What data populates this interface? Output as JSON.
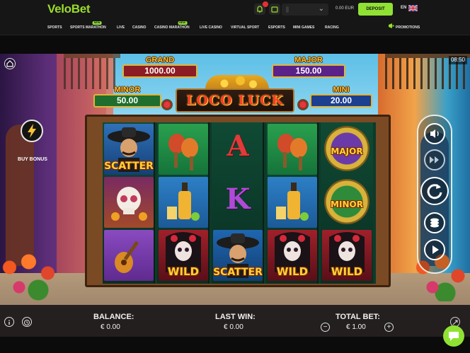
{
  "header": {
    "logo": "VeloBet",
    "balance_amount": "0.00",
    "balance_currency": "EUR",
    "deposit_label": "DEPOSIT",
    "language": "EN"
  },
  "nav": {
    "items": [
      {
        "label": "SPORTS"
      },
      {
        "label": "SPORTS MARATHON",
        "badge": "NEW"
      },
      {
        "label": "LIVE"
      },
      {
        "label": "CASINO"
      },
      {
        "label": "CASINO MARATHON",
        "badge": "NEW"
      },
      {
        "label": "LIVE CASINO"
      },
      {
        "label": "VIRTUAL SPORT"
      },
      {
        "label": "ESPORTS"
      },
      {
        "label": "MINI GAMES"
      },
      {
        "label": "RACING"
      }
    ],
    "promotions": "PROMOTIONS"
  },
  "game": {
    "clock": "08:50",
    "title": "LOCO LUCK",
    "jackpots": {
      "grand": {
        "label": "GRAND",
        "value": "1000.00"
      },
      "major": {
        "label": "MAJOR",
        "value": "150.00"
      },
      "minor": {
        "label": "MINOR",
        "value": "50.00"
      },
      "mini": {
        "label": "MINI",
        "value": "20.00"
      }
    },
    "buy_bonus": "BUY BONUS",
    "reels": [
      [
        {
          "symbol": "mariachi",
          "label": "SCATTER"
        },
        {
          "symbol": "skull",
          "label": ""
        },
        {
          "symbol": "guitar",
          "label": ""
        }
      ],
      [
        {
          "symbol": "maracas",
          "label": ""
        },
        {
          "symbol": "tequila",
          "label": ""
        },
        {
          "symbol": "catrina",
          "label": "WILD"
        }
      ],
      [
        {
          "symbol": "letter",
          "label": "A"
        },
        {
          "symbol": "letter",
          "label": "K"
        },
        {
          "symbol": "mariachi",
          "label": "SCATTER"
        }
      ],
      [
        {
          "symbol": "maracas",
          "label": ""
        },
        {
          "symbol": "tequila",
          "label": ""
        },
        {
          "symbol": "catrina",
          "label": "WILD"
        }
      ],
      [
        {
          "symbol": "coin",
          "label": "MAJOR"
        },
        {
          "symbol": "coin",
          "label": "MINOR"
        },
        {
          "symbol": "catrina",
          "label": "WILD"
        }
      ]
    ]
  },
  "footer": {
    "balance_label": "BALANCE:",
    "balance_value": "€ 0.00",
    "last_win_label": "LAST WIN:",
    "last_win_value": "€ 0.00",
    "total_bet_label": "TOTAL BET:",
    "total_bet_value": "€ 1.00",
    "minus": "−",
    "plus": "+"
  },
  "colors": {
    "brand": "#8fe233",
    "grand": "#8d1d24",
    "major": "#5a2189",
    "minor": "#1f6e2e",
    "mini": "#1c3f8f"
  }
}
